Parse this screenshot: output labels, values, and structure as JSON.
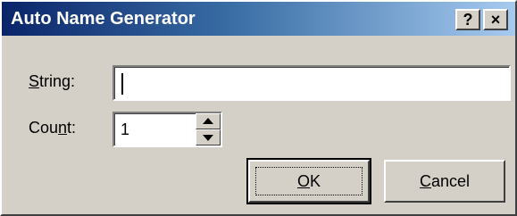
{
  "window": {
    "title": "Auto Name Generator",
    "help_glyph": "?",
    "close_glyph": "×"
  },
  "form": {
    "string": {
      "label_prefix": "",
      "label_access": "S",
      "label_rest": "tring:",
      "value": ""
    },
    "count": {
      "label_prefix": "Cou",
      "label_access": "n",
      "label_rest": "t:",
      "value": "1"
    }
  },
  "buttons": {
    "ok": {
      "access": "O",
      "rest": "K"
    },
    "cancel": {
      "access": "C",
      "rest": "ancel"
    }
  },
  "colors": {
    "title_gradient_start": "#0a246a",
    "title_gradient_end": "#a6caf0",
    "face": "#d4d0c8"
  }
}
